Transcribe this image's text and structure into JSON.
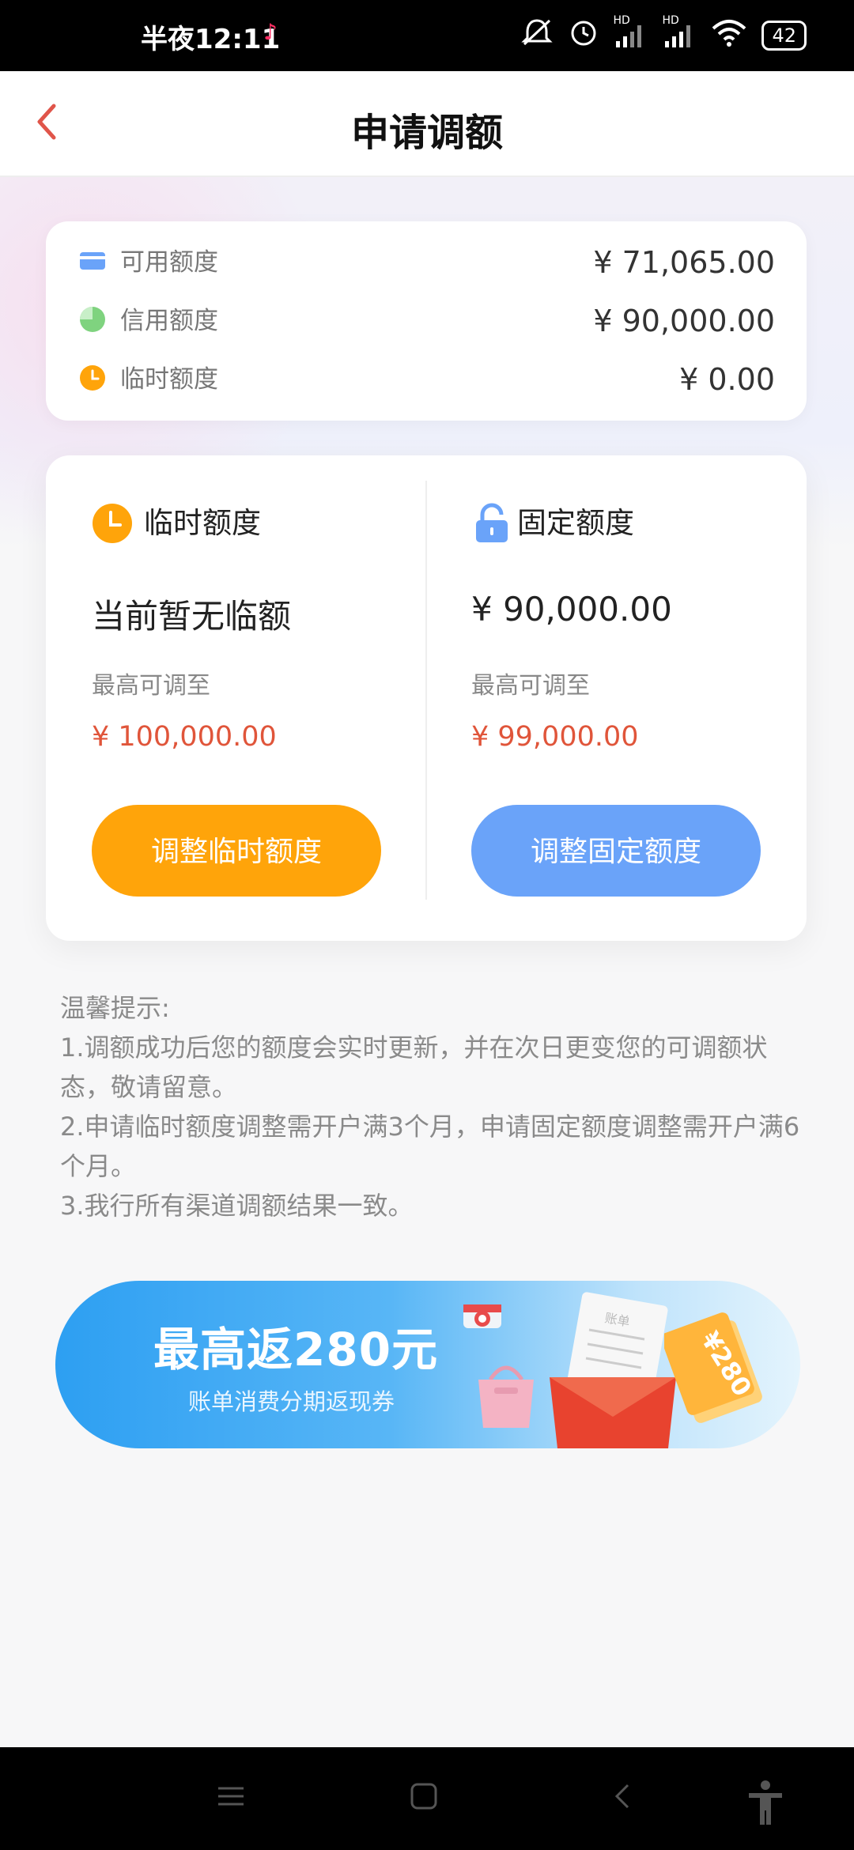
{
  "status_bar": {
    "time": "半夜12:11",
    "tiktok_icon": "♪",
    "signal_1": "HD",
    "signal_2": "HD",
    "battery": "42"
  },
  "header": {
    "title": "申请调额",
    "back_icon": "chevron-left-icon"
  },
  "summary": {
    "rows": [
      {
        "label": "可用额度",
        "value": "¥ 71,065.00",
        "icon": "card-icon",
        "color": "#6aa3f9"
      },
      {
        "label": "信用额度",
        "value": "¥ 90,000.00",
        "icon": "pie-icon",
        "color": "#7fd37f"
      },
      {
        "label": "临时额度",
        "value": "¥ 0.00",
        "icon": "clock-icon",
        "color": "#ffa40a"
      }
    ]
  },
  "temp_limit": {
    "title": "临时额度",
    "current": "当前暂无临额",
    "max_label": "最高可调至",
    "max_value": "¥ 100,000.00",
    "button": "调整临时额度"
  },
  "fixed_limit": {
    "title": "固定额度",
    "current": "¥ 90,000.00",
    "max_label": "最高可调至",
    "max_value": "¥ 99,000.00",
    "button": "调整固定额度"
  },
  "tips": {
    "heading": "温馨提示:",
    "lines": [
      "1.调额成功后您的额度会实时更新，并在次日更变您的可调额状态，敬请留意。",
      "2.申请临时额度调整需开户满3个月，申请固定额度调整需开户满6个月。",
      "3.我行所有渠道调额结果一致。"
    ]
  },
  "banner": {
    "title": "最高返280元",
    "subtitle": "账单消费分期返现券",
    "doc_label": "账单",
    "coupon_label": "¥280"
  },
  "colors": {
    "accent_red": "#e0553a",
    "orange": "#ffa40a",
    "blue": "#6aa3f9"
  }
}
